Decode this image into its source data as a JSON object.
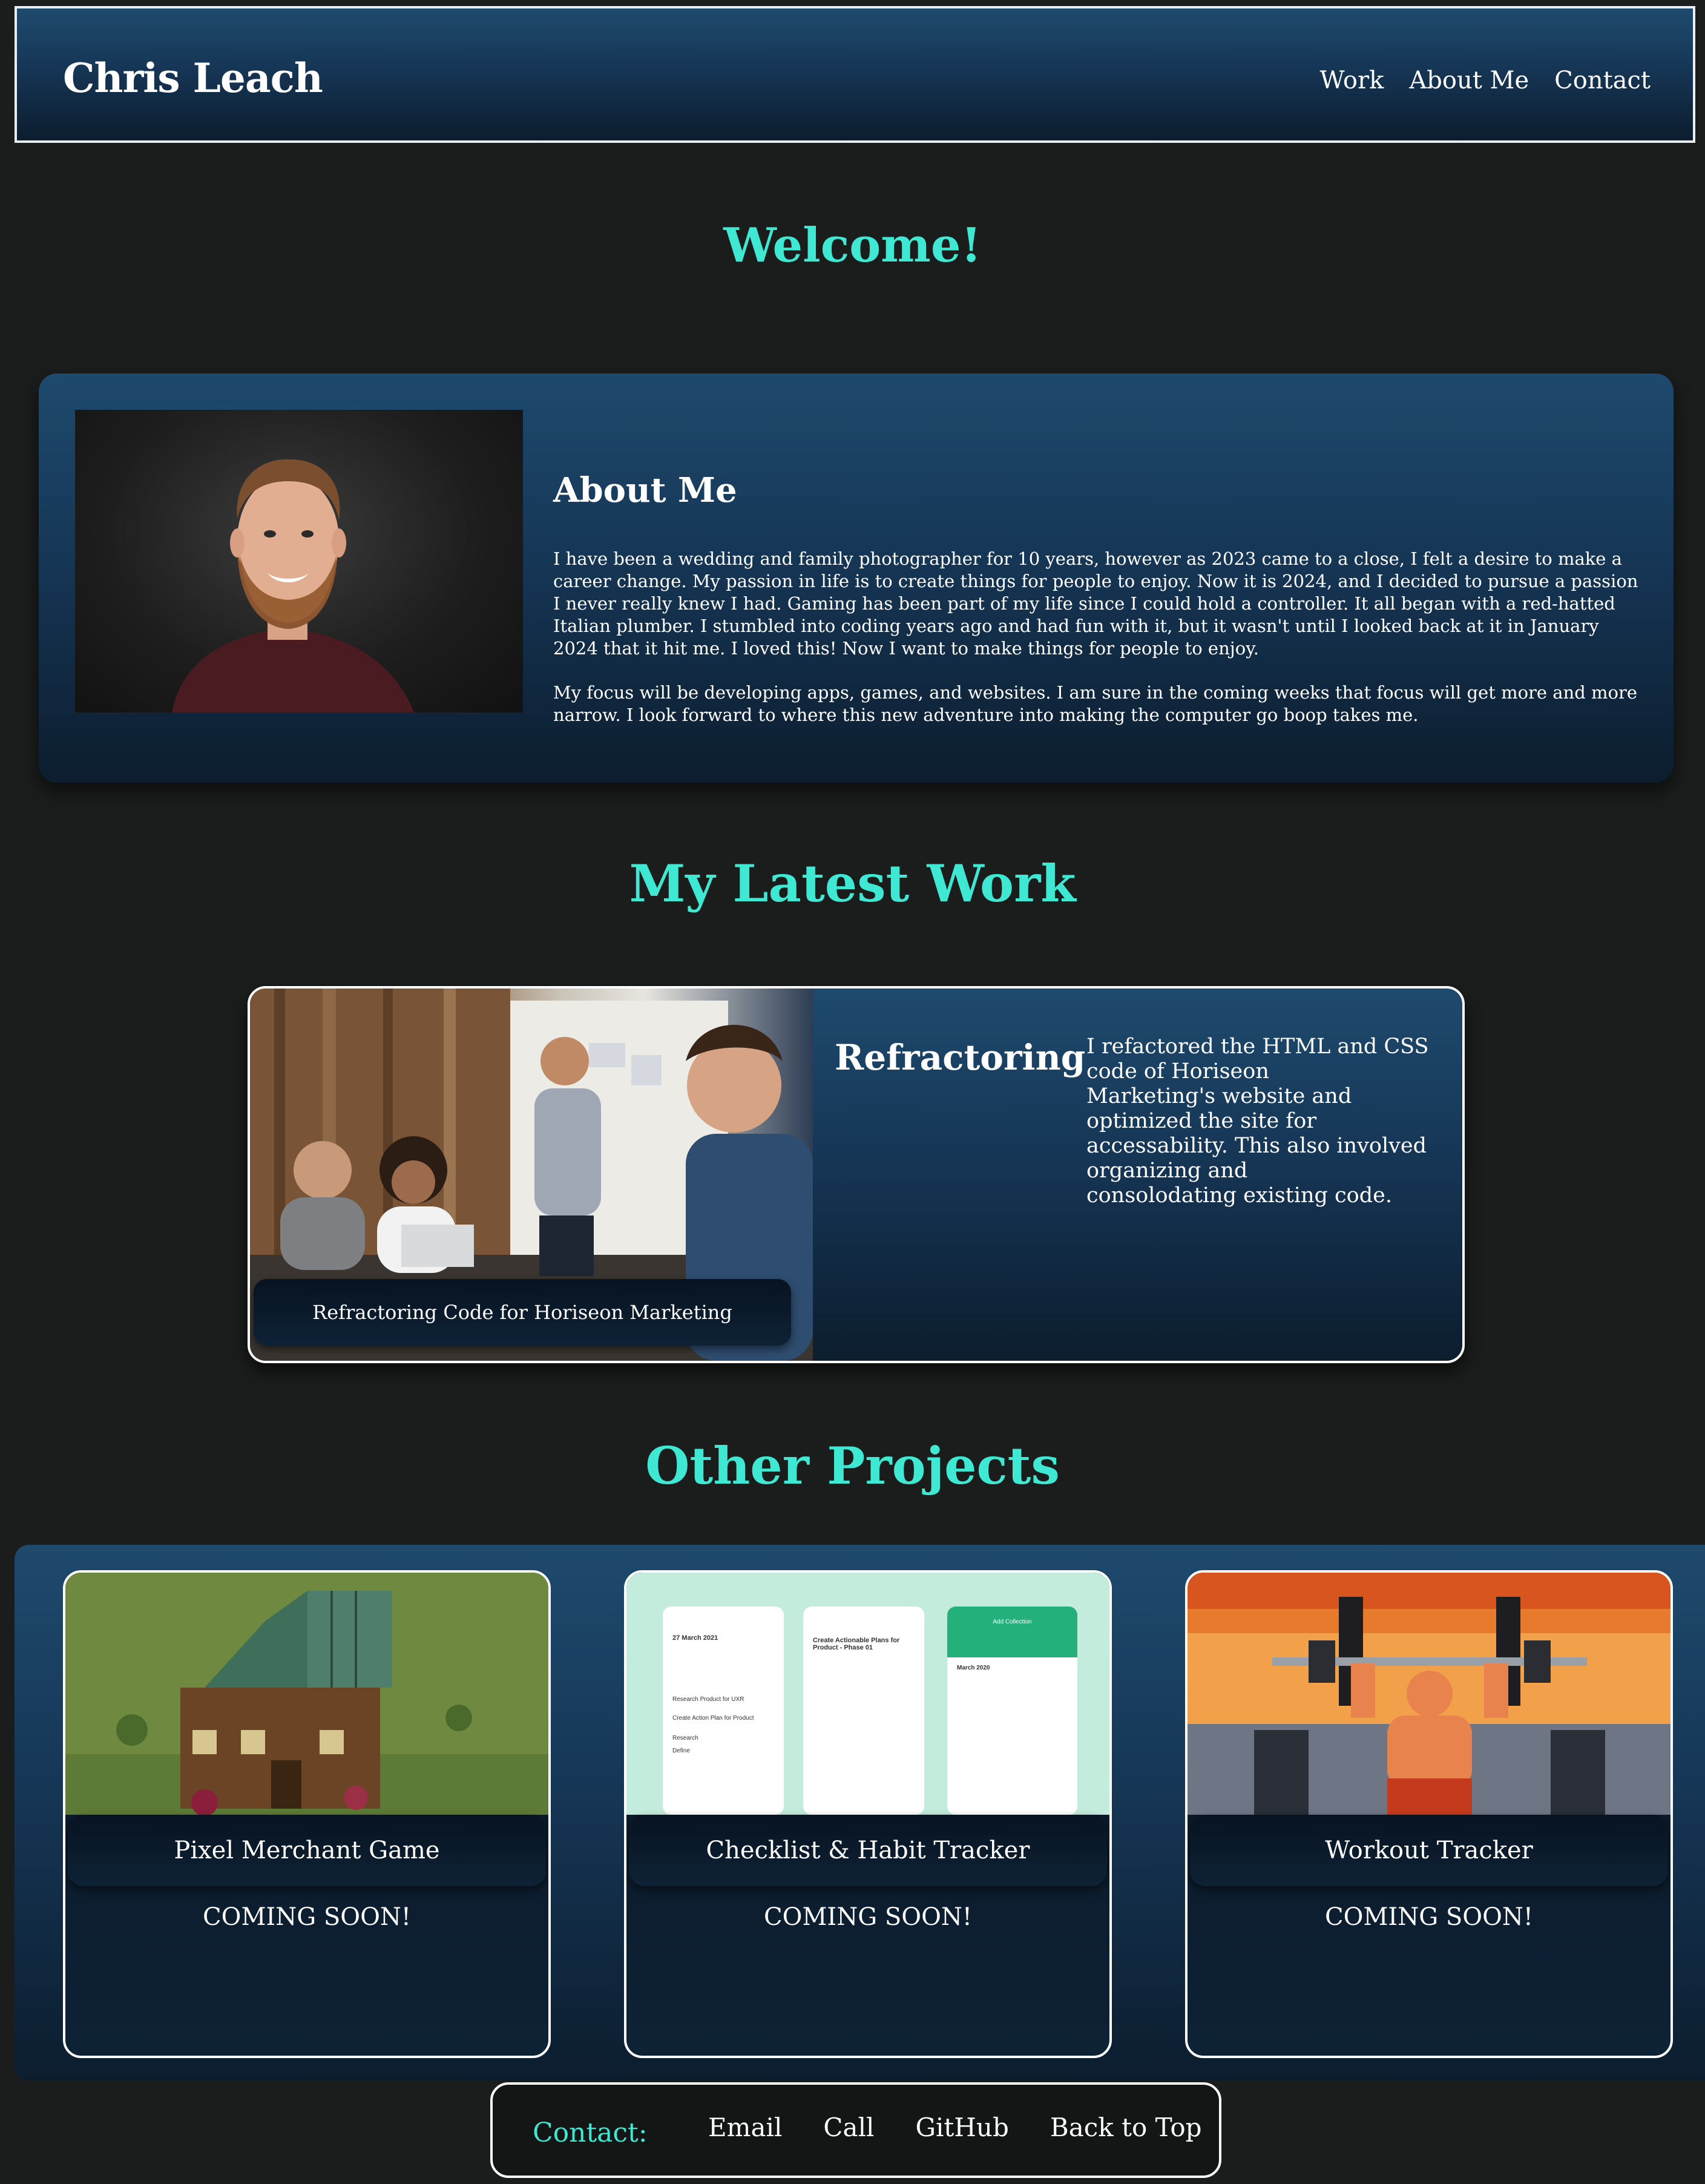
{
  "header": {
    "brand": "Chris Leach",
    "nav": [
      "Work",
      "About Me",
      "Contact"
    ]
  },
  "welcome": "Welcome!",
  "about": {
    "heading": "About Me",
    "paragraphs": [
      "I have been a wedding and family photographer for 10 years, however as 2023 came to a close, I felt a desire to make a career change. My passion in life is to create things for people to enjoy. Now it is 2024, and I decided to pursue a passion I never really knew I had. Gaming has been part of my life since I could hold a controller. It all began with a red-hatted Italian plumber. I stumbled into coding years ago and had fun with it, but it wasn't until I looked back at it in January 2024 that it hit me. I loved this! Now I want to make things for people to enjoy.",
      "My focus will be developing apps, games, and websites. I am sure in the coming weeks that focus will get more and more narrow. I look forward to where this new adventure into making the computer go boop takes me."
    ]
  },
  "latest_work": {
    "section_title": "My Latest Work",
    "caption": "Refractoring Code for Horiseon Marketing",
    "title": "Refractoring",
    "description_lines": [
      "I refactored the HTML and CSS code of Horiseon",
      "Marketing's website and optimized the site for",
      "accessability. This also involved organizing and",
      "consolodating existing code."
    ]
  },
  "other_projects": {
    "section_title": "Other Projects",
    "items": [
      {
        "caption": "Pixel Merchant Game",
        "status": "COMING SOON!"
      },
      {
        "caption": "Checklist & Habit Tracker",
        "status": "COMING SOON!"
      },
      {
        "caption": "Workout Tracker",
        "status": "COMING SOON!"
      }
    ]
  },
  "checklist_mock": {
    "date": "27 March 2021",
    "task_title": "Create Actionable Plans for Product - Phase 01",
    "panel_title": "Add Collection",
    "month": "March 2020",
    "items": [
      "Research Product for UXR",
      "Create Action Plan for Product",
      "Research",
      "Define"
    ]
  },
  "contact": {
    "label": "Contact:",
    "links": [
      "Email",
      "Call",
      "GitHub",
      "Back to Top"
    ]
  },
  "colors": {
    "background": "#1b1c1c",
    "accent": "#3ee8d2",
    "card_top": "#1e4a6e",
    "card_bottom": "#0c1d2e",
    "caption_bg": "#081320"
  }
}
